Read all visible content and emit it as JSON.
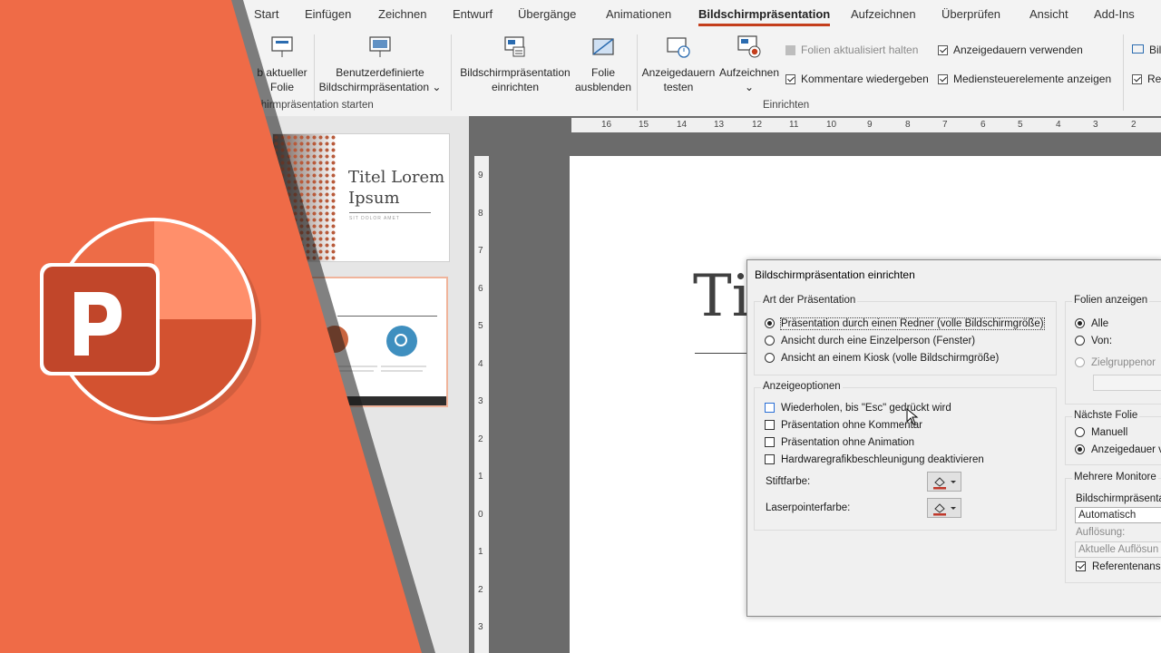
{
  "tabs": [
    "Start",
    "Einfügen",
    "Zeichnen",
    "Entwurf",
    "Übergänge",
    "Animationen",
    "Bildschirmpräsentation",
    "Aufzeichnen",
    "Überprüfen",
    "Ansicht",
    "Add-Ins"
  ],
  "active_tab": "Bildschirmpräsentation",
  "ribbon": {
    "from_current": [
      "b aktueller",
      "Folie"
    ],
    "custom_show": [
      "Benutzerdefinierte",
      "Bildschirmpräsentation ⌄"
    ],
    "setup_show": [
      "Bildschirmpräsentation",
      "einrichten"
    ],
    "hide_slide": [
      "Folie",
      "ausblenden"
    ],
    "rehearse": [
      "Anzeigedauern",
      "testen"
    ],
    "record": [
      "Aufzeichnen",
      "⌄"
    ],
    "keep_updated": "Folien aktualisiert halten",
    "play_narrations": "Kommentare wiedergeben",
    "use_timings": "Anzeigedauern verwenden",
    "show_media_controls": "Mediensteuerelemente anzeigen",
    "cut_right_1": "Bil",
    "cut_right_2": "Re",
    "group_start": "chirmpräsentation starten",
    "group_setup": "Einrichten"
  },
  "ruler": {
    "h": [
      "16",
      "15",
      "14",
      "13",
      "12",
      "11",
      "10",
      "9",
      "8",
      "7",
      "6",
      "5",
      "4",
      "3",
      "2"
    ],
    "v": [
      "9",
      "8",
      "7",
      "6",
      "5",
      "4",
      "3",
      "2",
      "1",
      "0",
      "1",
      "2",
      "3"
    ]
  },
  "thumbs": {
    "slide1_title": "Titel Lorem Ipsum",
    "slide1_subtitle": "SIT DOLOR AMET"
  },
  "slide_title_partial": "Ti",
  "dialog": {
    "title": "Bildschirmpräsentation einrichten",
    "art_label": "Art der Präsentation",
    "art_options": [
      "Präsentation durch einen Redner (volle Bildschirmgröße)",
      "Ansicht durch eine Einzelperson (Fenster)",
      "Ansicht an einem Kiosk (volle Bildschirmgröße)"
    ],
    "anzeige_label": "Anzeigeoptionen",
    "anzeige_options": [
      "Wiederholen, bis \"Esc\" gedrückt wird",
      "Präsentation ohne Kommentar",
      "Präsentation ohne Animation",
      "Hardwaregrafikbeschleunigung deaktivieren"
    ],
    "pen_color_label": "Stiftfarbe:",
    "laser_color_label": "Laserpointerfarbe:",
    "folien_label": "Folien anzeigen",
    "folien_all": "Alle",
    "folien_from": "Von:",
    "folien_custom": "Zielgruppenor",
    "next_label": "Nächste Folie",
    "next_manual": "Manuell",
    "next_timings": "Anzeigedauer v",
    "monitors_label": "Mehrere Monitore",
    "monitor_show_label": "Bildschirmpräsenta",
    "monitor_value": "Automatisch",
    "resolution_label": "Auflösung:",
    "resolution_value": "Aktuelle Auflösun",
    "presenter_view": "Referentenans"
  },
  "colors": {
    "accent": "#c43e1c",
    "overlay_orange": "#ef6b47",
    "logo_dark": "#b7472a",
    "logo_light": "#ff8f6b"
  }
}
